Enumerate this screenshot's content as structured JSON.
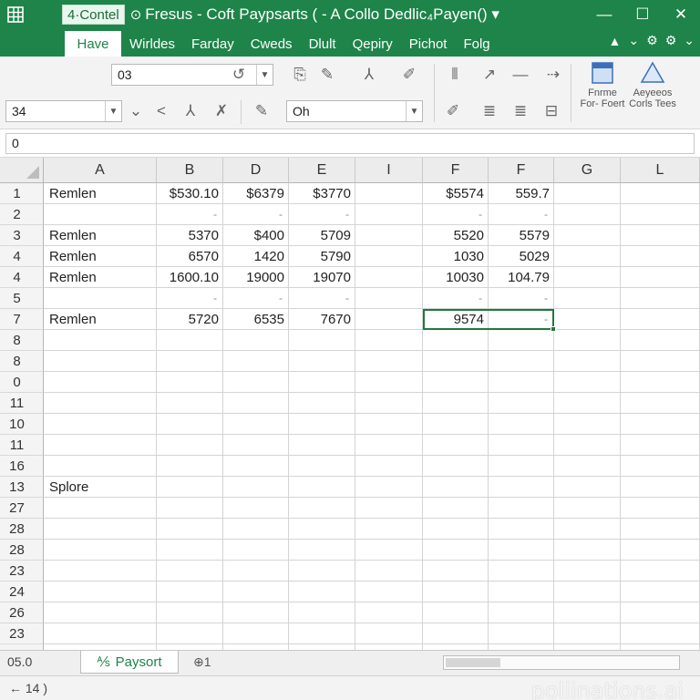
{
  "titlebar": {
    "autosave_label": "4·Contel",
    "title": "Fresus - Coft Paypsarts ( - A Collo Dedlic₄Payen() ▾",
    "minimize": "—",
    "maximize": "☐",
    "close": "✕"
  },
  "tabs": [
    "Have",
    "Wirldes",
    "Farday",
    "Cweds",
    "Dlult",
    "Qepiry",
    "Pichot",
    "Folg"
  ],
  "ribbon": {
    "font_name": "03",
    "font_size": "34",
    "style_box": "Oh",
    "format_label_1": "Fnrme For- Foert",
    "format_label_2": "Aeyeeos Corls Tees"
  },
  "formula": {
    "value": "0"
  },
  "columns": [
    "A",
    "B",
    "D",
    "E",
    "I",
    "F",
    "F",
    "G",
    "L"
  ],
  "rows": [
    {
      "num": "1",
      "cells": [
        "Remlen",
        "$530.10",
        "$6379",
        "$3770",
        "",
        "$5574",
        "559.7",
        "",
        ""
      ]
    },
    {
      "num": "2",
      "cells": [
        "",
        "-",
        "-",
        "-",
        "",
        "-",
        "-",
        "",
        ""
      ]
    },
    {
      "num": "3",
      "cells": [
        "Remlen",
        "5370",
        "$400",
        "5709",
        "",
        "5520",
        "5579",
        "",
        ""
      ]
    },
    {
      "num": "4",
      "cells": [
        "Remlen",
        "6570",
        "1420",
        "5790",
        "",
        "1030",
        "5029",
        "",
        ""
      ]
    },
    {
      "num": "4",
      "cells": [
        "Remlen",
        "1600.10",
        "19000",
        "19070",
        "",
        "10030",
        "104.79",
        "",
        ""
      ]
    },
    {
      "num": "5",
      "cells": [
        "",
        "-",
        "-",
        "-",
        "",
        "-",
        "-",
        "",
        ""
      ]
    },
    {
      "num": "7",
      "cells": [
        "Remlen",
        "5720",
        "6535",
        "7670",
        "",
        "9574",
        "-",
        "",
        ""
      ]
    },
    {
      "num": "8",
      "cells": [
        "",
        "",
        "",
        "",
        "",
        "",
        "",
        "",
        ""
      ]
    },
    {
      "num": "8",
      "cells": [
        "",
        "",
        "",
        "",
        "",
        "",
        "",
        "",
        ""
      ]
    },
    {
      "num": "0",
      "cells": [
        "",
        "",
        "",
        "",
        "",
        "",
        "",
        "",
        ""
      ]
    },
    {
      "num": "11",
      "cells": [
        "",
        "",
        "",
        "",
        "",
        "",
        "",
        "",
        ""
      ]
    },
    {
      "num": "10",
      "cells": [
        "",
        "",
        "",
        "",
        "",
        "",
        "",
        "",
        ""
      ]
    },
    {
      "num": "11",
      "cells": [
        "",
        "",
        "",
        "",
        "",
        "",
        "",
        "",
        ""
      ]
    },
    {
      "num": "16",
      "cells": [
        "",
        "",
        "",
        "",
        "",
        "",
        "",
        "",
        ""
      ]
    },
    {
      "num": "13",
      "cells": [
        "Splore",
        "",
        "",
        "",
        "",
        "",
        "",
        "",
        ""
      ]
    },
    {
      "num": "27",
      "cells": [
        "",
        "",
        "",
        "",
        "",
        "",
        "",
        "",
        ""
      ]
    },
    {
      "num": "28",
      "cells": [
        "",
        "",
        "",
        "",
        "",
        "",
        "",
        "",
        ""
      ]
    },
    {
      "num": "28",
      "cells": [
        "",
        "",
        "",
        "",
        "",
        "",
        "",
        "",
        ""
      ]
    },
    {
      "num": "23",
      "cells": [
        "",
        "",
        "",
        "",
        "",
        "",
        "",
        "",
        ""
      ]
    },
    {
      "num": "24",
      "cells": [
        "",
        "",
        "",
        "",
        "",
        "",
        "",
        "",
        ""
      ]
    },
    {
      "num": "26",
      "cells": [
        "",
        "",
        "",
        "",
        "",
        "",
        "",
        "",
        ""
      ]
    },
    {
      "num": "23",
      "cells": [
        "",
        "",
        "",
        "",
        "",
        "",
        "",
        "",
        ""
      ]
    },
    {
      "num": "",
      "cells": [
        "",
        "",
        "",
        "",
        "",
        "",
        "",
        "",
        ""
      ]
    }
  ],
  "sheetbar": {
    "nav_text": "05.0",
    "sheet_name": "Paysort",
    "add_text": "⊕1"
  },
  "status": {
    "text": "← 14 )"
  },
  "watermark": "pollinations.ai",
  "colors": {
    "accent": "#1e8449",
    "selection": "#1e7a3c"
  }
}
